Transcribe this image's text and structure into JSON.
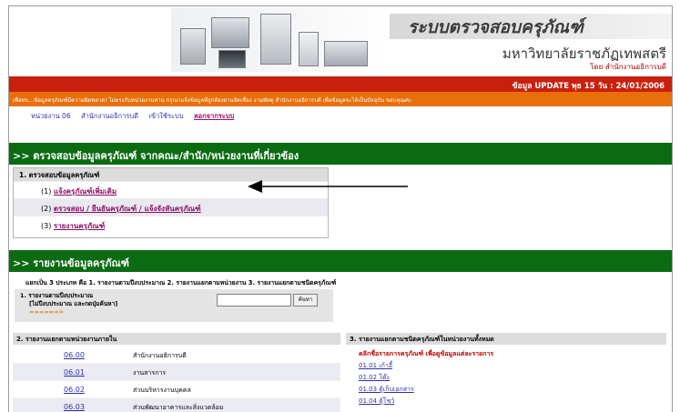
{
  "header": {
    "system_title": "ระบบตรวจสอบครุภัณฑ์",
    "university": "มหาวิทยาลัยราชภัฏเทพสตรี",
    "byline": "โดย สำนักงานอธิการบดี",
    "update_text": "ข้อมูล UPDATE พุธ 15 วัน : 24/01/2006",
    "notice": "เพื่อทบ...ข้อมูลครุภัณฑ์มีความผิดพลาด! ไม่ตรงกับหน่วยงานท่าน กรุณาแจ้งข้อมูลที่ถูกต้องผ่านจัดเชื่อง งานพัสดุ สำนักงานอธิการบดี เพื่อข้อมูลจะได้เป็นปัจจุบัน ขอบคุณค่ะ"
  },
  "nav": {
    "unit": "หน่วยงาน 06",
    "office": "สำนักงานอธิการบดี",
    "login": "เข้าใช้ระบบ",
    "logout": "ลอกจากระบบ"
  },
  "section1": {
    "title": ">> ตรวจสอบข้อมูลครุภัณฑ์ จากคณะ/สำนัก/หน่วยงานที่เกี่ยวข้อง",
    "box_title": "1. ตรวจสอบข้อมูลครุภัณฑ์",
    "items": [
      {
        "num": "(1)",
        "label": "แจ้งครุภัณฑ์เพิ่มเติม"
      },
      {
        "num": "(2)",
        "label": "ตรวจสอบ / ยืนยันครุภัณฑ์ / แจ้งจังหันครุภัณฑ์"
      },
      {
        "num": "(3)",
        "label": "รายงานครุภัณฑ์"
      }
    ]
  },
  "section2": {
    "title": ">> รายงานข้อมูลครุภัณฑ์",
    "summary": "แยกเป็น 3 ประเภท คือ 1. รายงานตามปีงบประมาณ 2. รายงานแยกตามหน่วยงาน 3. รายงานแยกตามชนิดครุภัณฑ์",
    "budget_label1": "1. รายงานตามปีงบประมาณ",
    "budget_label2": "[ไม่ปีงบประมาณ และกดปุ่มค้นหา]",
    "budget_label3": "======>",
    "search_value": "",
    "search_button": "ค้นหา",
    "list2_title": "2. รายงานแยกตามหน่วยงานภายใน",
    "list3_title": "3. รายงานแยกตามชนิดครุภัณฑ์ในหน่วยงานทั้งหมด",
    "units": [
      {
        "code": "06.00",
        "name": "สำนักงานอธิการบดี"
      },
      {
        "code": "06.01",
        "name": "งานสารการ"
      },
      {
        "code": "06.02",
        "name": "ส่วนบริหารงานบุคคล"
      },
      {
        "code": "06.03",
        "name": "ส่วนพัฒนาอาคารและสิ่งแวดล้อม"
      }
    ],
    "types_note": "คลิกชื่อรายการครุภัณฑ์ เพื่อดูข้อมูลแต่ละรายการ",
    "types": [
      "01.01  เก้าอี้",
      "01.02  โต๊ะ",
      "01.03  ตู้เก็บเอกสาร",
      "01.04  ตู้โชว์"
    ]
  }
}
